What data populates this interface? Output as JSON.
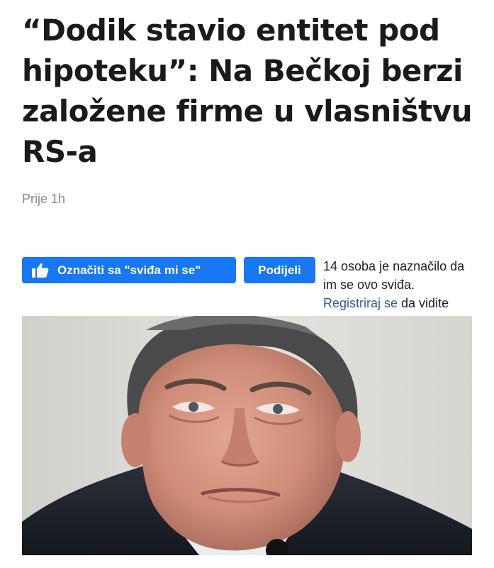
{
  "article": {
    "headline": "“Dodik stavio entitet pod hipoteku”: Na Bečkoj berzi založene firme u vlasništvu RS-a",
    "timestamp": "Prije 1h"
  },
  "facebook": {
    "like_label": "Označiti sa \"sviđa mi se\"",
    "share_label": "Podijeli",
    "like_count_text": "14 osoba je naznačilo da im se ovo sviđa.",
    "register_link": "Registriraj se",
    "register_suffix": " da vidite",
    "like_icon": "thumbs-up-icon",
    "button_color": "#1877f2",
    "link_color": "#385898"
  },
  "photo": {
    "subject": "man-portrait"
  }
}
